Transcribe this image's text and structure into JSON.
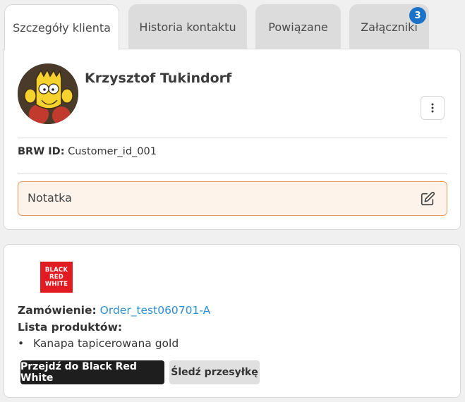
{
  "tabs": [
    {
      "label": "Szczegóły klienta"
    },
    {
      "label": "Historia kontaktu"
    },
    {
      "label": "Powiązane"
    },
    {
      "label": "Załączniki",
      "badge": "3"
    }
  ],
  "client": {
    "name": "Krzysztof Tukindorf",
    "brw_label": "BRW ID:",
    "brw_value": "Customer_id_001"
  },
  "note": {
    "label": "Notatka"
  },
  "order": {
    "brand_logo_lines": [
      "BLACK",
      "RED",
      "WHITE"
    ],
    "order_label": "Zamówienie:",
    "order_value": "Order_test060701-A",
    "products_label": "Lista produktów:",
    "products": [
      "Kanapa tapicerowana gold"
    ],
    "primary_button": "Przejdź do Black Red White",
    "secondary_button": "Śledź przesyłkę"
  },
  "colors": {
    "accent_blue": "#1a73c9",
    "note_border": "#e69a5f",
    "note_bg": "#fdf3ea",
    "brand_red": "#e21b23",
    "link": "#2f8fd0"
  },
  "icons": {
    "menu": "more-vertical-icon",
    "edit": "edit-square-icon"
  }
}
